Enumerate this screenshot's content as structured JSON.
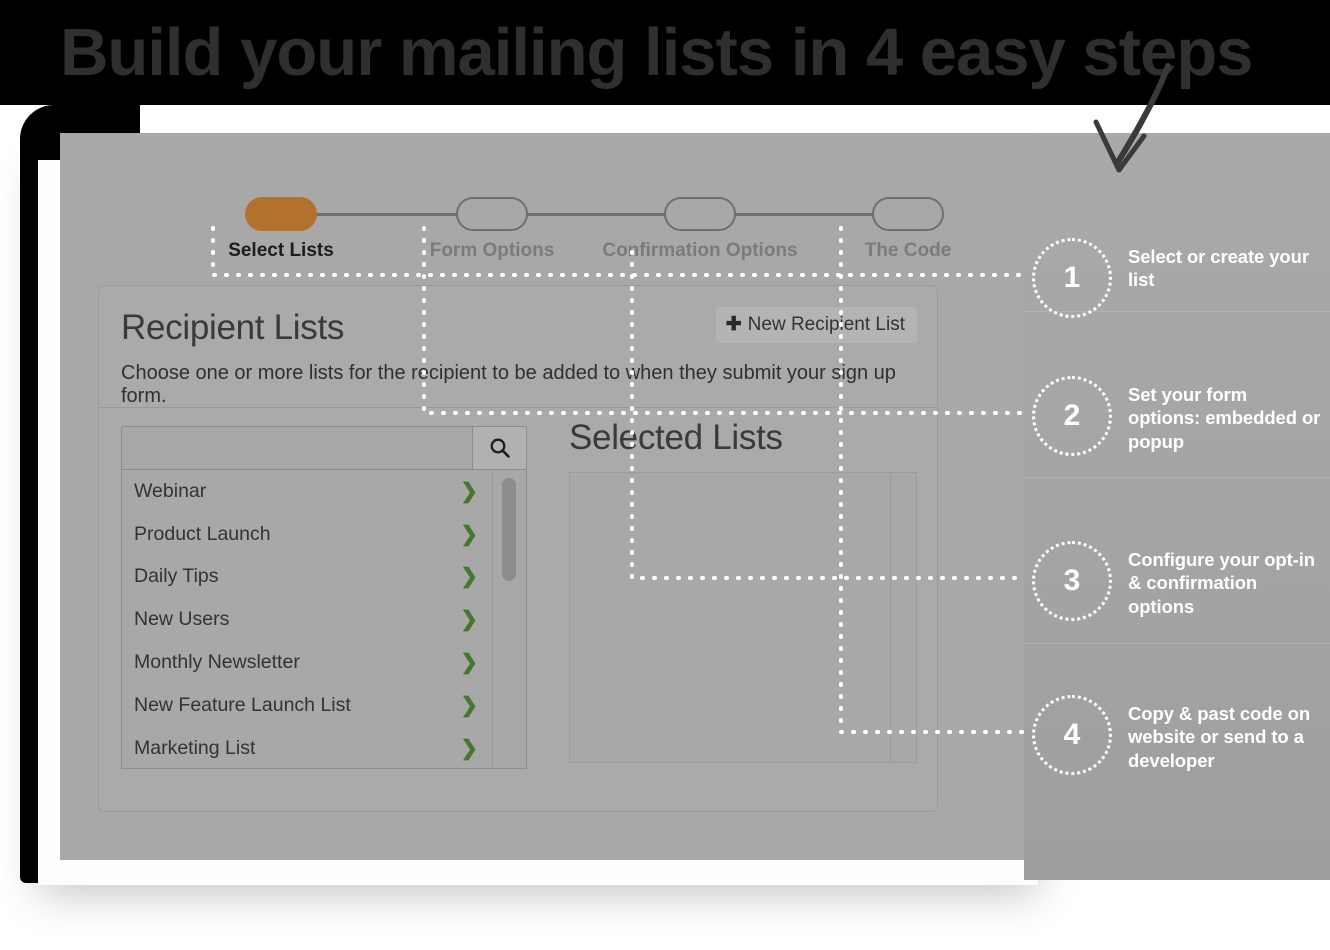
{
  "headline": "Build your mailing lists in 4 easy steps",
  "stepper": {
    "steps": [
      {
        "label": "Select Lists",
        "active": true
      },
      {
        "label": "Form Options",
        "active": false
      },
      {
        "label": "Confirmation Options",
        "active": false
      },
      {
        "label": "The Code",
        "active": false
      }
    ],
    "next_label": "›",
    "active_color": "#b3712e"
  },
  "panel": {
    "title": "Recipient Lists",
    "subtitle": "Choose one or more lists for the recipient to be added to when they submit your sign up form.",
    "new_list_button": "New Recipient List",
    "plus_icon": "✚"
  },
  "search": {
    "value": "",
    "placeholder": "",
    "icon": "search-icon"
  },
  "available_lists": [
    {
      "name": "Webinar",
      "chevron": "❯"
    },
    {
      "name": "Product Launch",
      "chevron": "❯"
    },
    {
      "name": "Daily Tips",
      "chevron": "❯"
    },
    {
      "name": "New Users",
      "chevron": "❯"
    },
    {
      "name": "Monthly Newsletter",
      "chevron": "❯"
    },
    {
      "name": "New Feature Launch List",
      "chevron": "❯"
    },
    {
      "name": "Marketing List",
      "chevron": "❯"
    }
  ],
  "selected": {
    "title": "Selected Lists",
    "items": []
  },
  "annotations": [
    {
      "number": "1",
      "text": "Select or create your list"
    },
    {
      "number": "2",
      "text": "Set your form options: embedded or popup"
    },
    {
      "number": "3",
      "text": "Configure your opt-in & confirmation options"
    },
    {
      "number": "4",
      "text": "Copy & past code on website or send to a developer"
    }
  ],
  "colors": {
    "accent": "#b3712e",
    "chevron_green": "#44772f",
    "panel_bg": "#a8a8a8",
    "annotation_text": "#ffffff",
    "headline_text": "#2f2f2f"
  }
}
